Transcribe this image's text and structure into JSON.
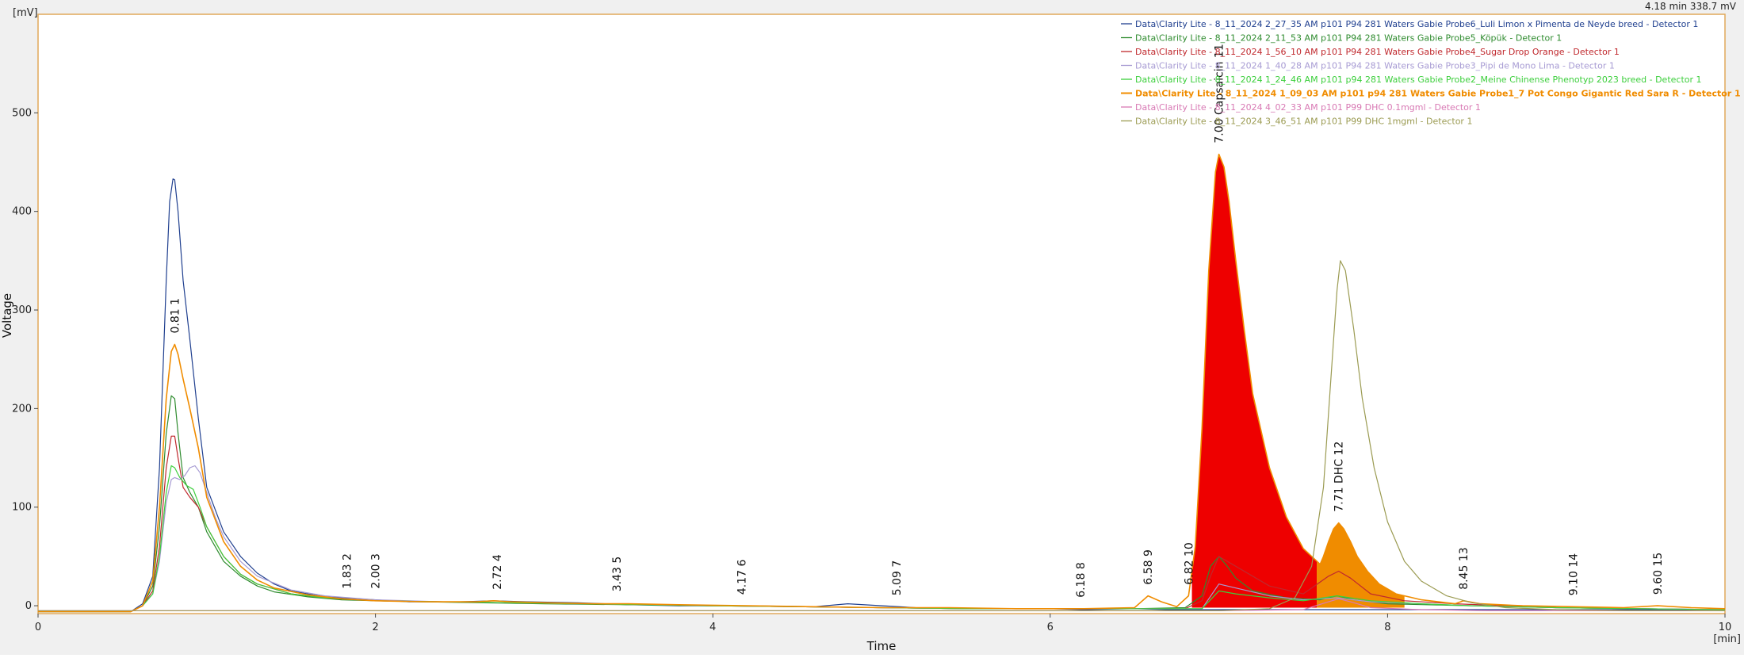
{
  "chart_data": {
    "type": "line",
    "xlabel": "Time",
    "ylabel": "Voltage",
    "x_unit": "[min]",
    "y_unit": "[mV]",
    "xlim": [
      0,
      10
    ],
    "ylim": [
      -8,
      600
    ],
    "x_ticks": [
      0,
      2,
      4,
      6,
      8,
      10
    ],
    "y_ticks": [
      0,
      100,
      200,
      300,
      400,
      500
    ],
    "grid": false,
    "legend_position": "top-right",
    "cursor_readout": "4.18 min   338.7 mV",
    "series": [
      {
        "name": "Data\\Clarity Lite - 8_11_2024 2_27_35 AM p101 P94 281 Waters Gabie Probe6_Luli Limon x Pimenta de Neyde breed - Detector 1",
        "color": "#1f3f8f",
        "bold": false,
        "x": [
          0,
          0.55,
          0.62,
          0.68,
          0.72,
          0.76,
          0.78,
          0.8,
          0.81,
          0.83,
          0.86,
          0.9,
          0.95,
          1.0,
          1.1,
          1.2,
          1.3,
          1.4,
          1.5,
          1.7,
          1.9,
          2.0,
          2.2,
          2.5,
          2.7,
          2.9,
          3.2,
          3.5,
          3.8,
          4.2,
          4.6,
          4.8,
          5.2,
          5.6,
          6.0,
          6.2,
          6.5,
          6.7,
          6.8,
          6.9,
          7.0,
          7.1,
          7.3,
          7.5,
          7.7,
          7.9,
          8.1,
          8.3,
          8.5,
          8.8,
          9.0,
          9.3,
          9.6,
          10.0
        ],
        "y": [
          -6,
          -6,
          2,
          30,
          140,
          330,
          410,
          433,
          432,
          400,
          330,
          270,
          190,
          120,
          75,
          50,
          33,
          22,
          15,
          9,
          7,
          6,
          4,
          4,
          5,
          4,
          3,
          1,
          0,
          0,
          -1,
          2,
          -2,
          -3,
          -3,
          -4,
          -3,
          -4,
          -4,
          -4,
          -4,
          -4,
          -4,
          -4,
          -4,
          -4,
          -4,
          -4,
          -4,
          -4,
          -4,
          -4,
          -4,
          -4
        ]
      },
      {
        "name": "Data\\Clarity Lite - 8_11_2024 2_11_53 AM p101 P94 281 Waters Gabie Probe5_Köpük - Detector 1",
        "color": "#2e8b2e",
        "bold": false,
        "x": [
          0,
          0.55,
          0.62,
          0.68,
          0.72,
          0.76,
          0.79,
          0.81,
          0.83,
          0.86,
          0.9,
          0.95,
          1.0,
          1.1,
          1.2,
          1.3,
          1.4,
          1.6,
          1.8,
          2.0,
          2.3,
          2.6,
          3.0,
          3.5,
          4.0,
          4.5,
          5.0,
          5.5,
          6.0,
          6.5,
          6.8,
          6.9,
          6.95,
          7.0,
          7.05,
          7.1,
          7.2,
          7.4,
          7.6,
          7.7,
          7.8,
          8.0,
          8.5,
          9.0,
          9.5,
          10.0
        ],
        "y": [
          -6,
          -6,
          0,
          20,
          80,
          175,
          213,
          210,
          175,
          130,
          115,
          100,
          75,
          45,
          30,
          20,
          14,
          9,
          6,
          5,
          4,
          3,
          2,
          1,
          0,
          -1,
          -2,
          -3,
          -3,
          -3,
          -2,
          10,
          40,
          50,
          40,
          28,
          15,
          8,
          6,
          10,
          6,
          2,
          0,
          -2,
          -3,
          -4
        ]
      },
      {
        "name": "Data\\Clarity Lite - 8_11_2024 1_56_10 AM p101 P94 281 Waters Gabie Probe4_Sugar Drop Orange - Detector 1",
        "color": "#c0282d",
        "bold": false,
        "x": [
          0,
          0.55,
          0.62,
          0.68,
          0.72,
          0.76,
          0.79,
          0.81,
          0.83,
          0.86,
          0.9,
          0.95,
          1.0,
          1.1,
          1.2,
          1.3,
          1.5,
          1.7,
          2.0,
          2.4,
          2.8,
          3.2,
          3.6,
          4.0,
          4.5,
          5.0,
          5.5,
          6.0,
          6.5,
          6.8,
          6.9,
          6.95,
          7.0,
          7.1,
          7.3,
          7.5,
          7.65,
          7.71,
          7.78,
          7.9,
          8.1,
          8.4,
          8.7,
          9.0,
          9.5,
          10.0
        ],
        "y": [
          -6,
          -6,
          0,
          15,
          60,
          140,
          172,
          172,
          150,
          120,
          110,
          100,
          80,
          50,
          32,
          22,
          12,
          8,
          5,
          4,
          3,
          2,
          1,
          0,
          -1,
          -2,
          -3,
          -3,
          -3,
          -3,
          5,
          30,
          50,
          40,
          20,
          12,
          30,
          35,
          28,
          12,
          5,
          2,
          0,
          -2,
          -3,
          -4
        ]
      },
      {
        "name": "Data\\Clarity Lite - 8_11_2024 1_40_28 AM p101 P94 281 Waters Gabie Probe3_Pipi de Mono Lima - Detector 1",
        "color": "#a79bd3",
        "bold": false,
        "x": [
          0,
          0.55,
          0.62,
          0.68,
          0.72,
          0.76,
          0.79,
          0.81,
          0.84,
          0.87,
          0.9,
          0.93,
          0.96,
          1.0,
          1.05,
          1.1,
          1.2,
          1.3,
          1.5,
          1.7,
          2.0,
          2.4,
          2.8,
          3.2,
          3.6,
          4.0,
          4.5,
          5.0,
          5.5,
          6.0,
          6.5,
          6.9,
          7.0,
          7.1,
          7.3,
          7.5,
          7.7,
          7.9,
          8.2,
          8.5,
          9.0,
          9.5,
          10.0
        ],
        "y": [
          -6,
          -6,
          0,
          12,
          45,
          105,
          128,
          130,
          128,
          132,
          140,
          142,
          135,
          115,
          90,
          70,
          45,
          30,
          16,
          10,
          6,
          4,
          3,
          2,
          1,
          0,
          -1,
          -2,
          -3,
          -3,
          -3,
          -3,
          22,
          18,
          10,
          6,
          8,
          4,
          2,
          0,
          -2,
          -3,
          -4
        ]
      },
      {
        "name": "Data\\Clarity Lite - 8_11_2024 1_24_46 AM p101 p94 281 Waters Gabie Probe2_Meine Chinense Phenotyp 2023 breed - Detector 1",
        "color": "#3ccf3c",
        "bold": false,
        "x": [
          0,
          0.55,
          0.62,
          0.68,
          0.72,
          0.76,
          0.79,
          0.81,
          0.84,
          0.88,
          0.92,
          0.96,
          1.0,
          1.1,
          1.2,
          1.3,
          1.5,
          1.7,
          2.0,
          2.4,
          2.8,
          3.2,
          3.6,
          4.0,
          4.5,
          5.0,
          5.5,
          6.0,
          6.5,
          6.9,
          7.0,
          7.1,
          7.3,
          7.5,
          7.7,
          7.9,
          8.2,
          8.5,
          9.0,
          9.5,
          10.0
        ],
        "y": [
          -6,
          -6,
          0,
          12,
          50,
          115,
          142,
          140,
          130,
          122,
          118,
          100,
          80,
          50,
          32,
          22,
          12,
          8,
          5,
          4,
          3,
          2,
          1,
          0,
          -1,
          -2,
          -3,
          -3,
          -3,
          -3,
          15,
          12,
          8,
          5,
          10,
          5,
          2,
          0,
          -2,
          -3,
          -4
        ]
      },
      {
        "name": "Data\\Clarity Lite - 8_11_2024 1_09_03 AM p101 p94 281 Waters Gabie Probe1_7 Pot Congo Gigantic Red Sara R - Detector 1",
        "color": "#f08c00",
        "bold": true,
        "x": [
          0,
          0.55,
          0.62,
          0.68,
          0.72,
          0.76,
          0.79,
          0.81,
          0.83,
          0.86,
          0.9,
          0.95,
          1.0,
          1.1,
          1.2,
          1.3,
          1.4,
          1.6,
          1.8,
          2.0,
          2.3,
          2.6,
          2.7,
          2.8,
          3.0,
          3.3,
          3.5,
          3.8,
          4.2,
          4.6,
          5.0,
          5.4,
          5.8,
          6.2,
          6.5,
          6.58,
          6.66,
          6.75,
          6.82,
          6.86,
          6.9,
          6.94,
          6.98,
          7.0,
          7.03,
          7.06,
          7.1,
          7.15,
          7.2,
          7.3,
          7.4,
          7.5,
          7.6,
          7.62,
          7.65,
          7.68,
          7.71,
          7.74,
          7.78,
          7.82,
          7.88,
          7.95,
          8.05,
          8.2,
          8.4,
          8.45,
          8.55,
          8.8,
          9.1,
          9.4,
          9.6,
          9.8,
          10.0
        ],
        "y": [
          -6,
          -6,
          0,
          25,
          100,
          210,
          258,
          265,
          255,
          230,
          200,
          160,
          110,
          65,
          40,
          26,
          18,
          11,
          7,
          5,
          4,
          4,
          5,
          4,
          3,
          2,
          2,
          1,
          0,
          -1,
          -2,
          -2,
          -3,
          -3,
          -2,
          10,
          4,
          -1,
          10,
          60,
          180,
          340,
          440,
          458,
          445,
          410,
          350,
          280,
          215,
          140,
          90,
          58,
          42,
          50,
          65,
          78,
          84,
          78,
          65,
          50,
          35,
          22,
          12,
          6,
          2,
          5,
          2,
          0,
          -1,
          -2,
          0,
          -2,
          -3
        ]
      },
      {
        "name": "Data\\Clarity Lite - 8_11_2024 4_02_33 AM p101 P99 DHC 0.1mgml - Detector 1",
        "color": "#d879b4",
        "bold": false,
        "x": [
          0,
          1.0,
          2.0,
          3.0,
          4.0,
          5.0,
          6.0,
          7.0,
          7.5,
          7.65,
          7.71,
          7.78,
          7.9,
          8.2,
          8.6,
          9.0,
          10.0
        ],
        "y": [
          -5,
          -5,
          -5,
          -5,
          -5,
          -5,
          -5,
          -5,
          -4,
          4,
          7,
          4,
          -2,
          -4,
          -5,
          -5,
          -5
        ]
      },
      {
        "name": "Data\\Clarity Lite - 8_11_2024 3_46_51 AM p101 P99 DHC 1mgml - Detector 1",
        "color": "#9b9b52",
        "bold": false,
        "x": [
          0,
          1.0,
          2.0,
          3.0,
          4.0,
          5.0,
          6.0,
          7.0,
          7.3,
          7.45,
          7.55,
          7.62,
          7.66,
          7.7,
          7.72,
          7.75,
          7.8,
          7.85,
          7.92,
          8.0,
          8.1,
          8.2,
          8.35,
          8.5,
          8.7,
          9.0,
          9.5,
          10.0
        ],
        "y": [
          -5,
          -5,
          -5,
          -5,
          -5,
          -5,
          -5,
          -5,
          -3,
          8,
          40,
          120,
          220,
          320,
          350,
          340,
          280,
          210,
          140,
          85,
          45,
          25,
          10,
          3,
          -2,
          -4,
          -5,
          -5
        ]
      }
    ],
    "filled_peaks": [
      {
        "series_index": 5,
        "x_from": 6.84,
        "x_to": 7.58,
        "color": "#ee0000"
      },
      {
        "series_index": 5,
        "x_from": 7.58,
        "x_to": 8.1,
        "color": "#f08c00"
      }
    ],
    "peak_annotations": [
      {
        "x": 0.81,
        "y": 265,
        "time": "0.81",
        "number": "1",
        "name": ""
      },
      {
        "x": 1.83,
        "y": 6,
        "time": "1.83",
        "number": "2",
        "name": ""
      },
      {
        "x": 2.0,
        "y": 6,
        "time": "2.00",
        "number": "3",
        "name": ""
      },
      {
        "x": 2.72,
        "y": 5,
        "time": "2.72",
        "number": "4",
        "name": ""
      },
      {
        "x": 3.43,
        "y": 3,
        "time": "3.43",
        "number": "5",
        "name": ""
      },
      {
        "x": 4.17,
        "y": 0,
        "time": "4.17",
        "number": "6",
        "name": ""
      },
      {
        "x": 5.09,
        "y": -1,
        "time": "5.09",
        "number": "7",
        "name": ""
      },
      {
        "x": 6.18,
        "y": -3,
        "time": "6.18",
        "number": "8",
        "name": ""
      },
      {
        "x": 6.58,
        "y": 10,
        "time": "6.58",
        "number": "9",
        "name": ""
      },
      {
        "x": 6.82,
        "y": 10,
        "time": "6.82",
        "number": "10",
        "name": ""
      },
      {
        "x": 7.0,
        "y": 458,
        "time": "7.00",
        "number": "11",
        "name": "Capsaicin"
      },
      {
        "x": 7.71,
        "y": 84,
        "time": "7.71",
        "number": "12",
        "name": "DHC"
      },
      {
        "x": 8.45,
        "y": 5,
        "time": "8.45",
        "number": "13",
        "name": ""
      },
      {
        "x": 9.1,
        "y": -1,
        "time": "9.10",
        "number": "14",
        "name": ""
      },
      {
        "x": 9.6,
        "y": 0,
        "time": "9.60",
        "number": "15",
        "name": ""
      }
    ]
  }
}
